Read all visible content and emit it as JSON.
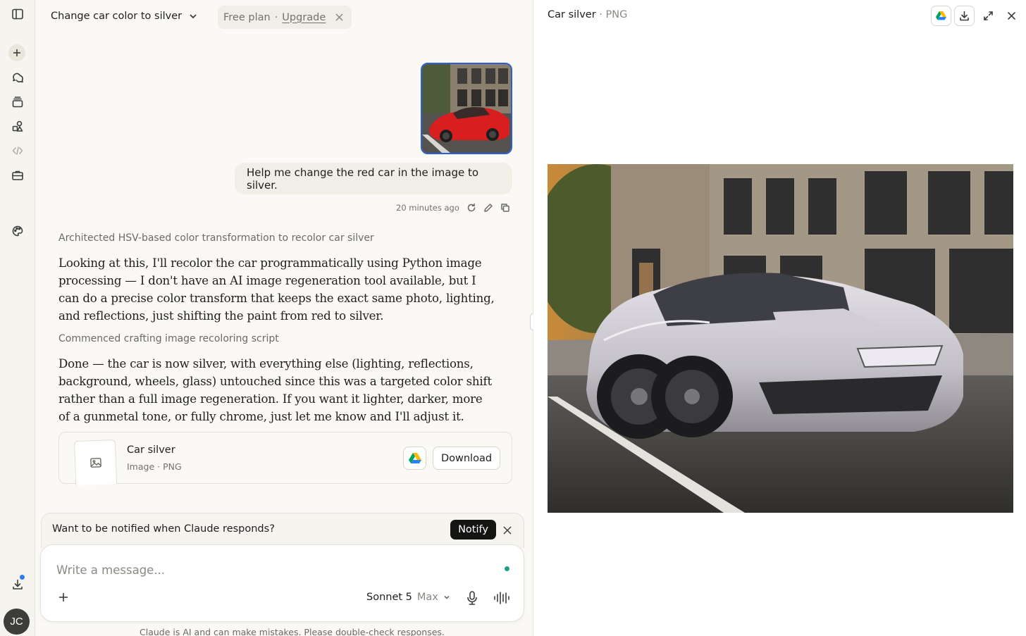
{
  "sidebar": {
    "avatar_initials": "JC"
  },
  "header": {
    "chat_title": "Change car color to silver",
    "plan_label": "Free plan",
    "plan_separator": "·",
    "upgrade_label": "Upgrade"
  },
  "conversation": {
    "user_message": "Help me change the red car in the image to silver.",
    "timestamp": "20 minutes ago",
    "thinking_1": "Architected HSV-based color transformation to recolor car silver",
    "response_1": "Looking at this, I'll recolor the car programmatically using Python image processing — I don't have an AI image regeneration tool available, but I can do a precise color transform that keeps the exact same photo, lighting, and reflections, just shifting the paint from red to silver.",
    "thinking_2": "Commenced crafting image recoloring script",
    "response_2": "Done — the car is now silver, with everything else (lighting, reflections, background, wheels, glass) untouched since this was a targeted color shift rather than a full image regeneration. If you want it lighter, darker, more of a gunmetal tone, or fully chrome, just let me know and I'll adjust it."
  },
  "artifact": {
    "title": "Car silver",
    "subtitle": "Image · PNG",
    "download_label": "Download"
  },
  "notify": {
    "text": "Want to be notified when Claude responds?",
    "button_label": "Notify"
  },
  "composer": {
    "placeholder": "Write a message...",
    "model_name": "Sonnet 5",
    "model_mode": "Max",
    "disclaimer": "Claude is AI and can make mistakes. Please double-check responses."
  },
  "panel": {
    "title": "Car silver",
    "format": "PNG"
  },
  "colors": {
    "accent_selection": "#2c5fd6",
    "notify_button": "#141413",
    "status_dot": "#1f9d86",
    "notification_dot": "#2e7bea",
    "original_car": "#d81e1e",
    "recolored_car": "#c9c7cf"
  }
}
